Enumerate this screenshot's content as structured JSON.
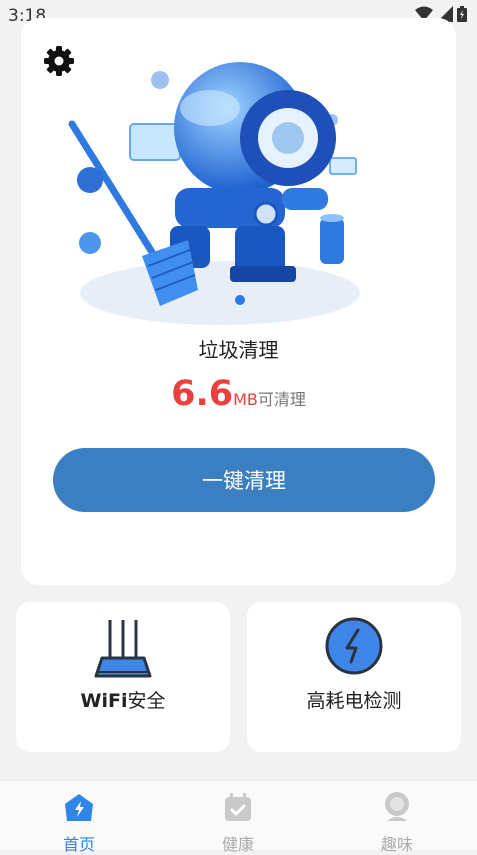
{
  "status_bar": {
    "time": "3:18"
  },
  "main": {
    "title": "垃圾清理",
    "size_value": "6.6",
    "size_unit": "MB",
    "size_suffix": "可清理",
    "clean_button": "一键清理"
  },
  "tools": [
    {
      "label_strong": "WiFi",
      "label_rest": "安全",
      "icon": "router-icon"
    },
    {
      "label": "高耗电检测",
      "icon": "lightning-circle-icon"
    }
  ],
  "bottom_nav": [
    {
      "label": "首页",
      "icon": "home-icon",
      "active": true
    },
    {
      "label": "健康",
      "icon": "calendar-check-icon",
      "active": false
    },
    {
      "label": "趣味",
      "icon": "face-icon",
      "active": false
    }
  ],
  "colors": {
    "accent": "#3a7fc1",
    "highlight": "#ee3f3f",
    "nav_active": "#2f86e6"
  }
}
